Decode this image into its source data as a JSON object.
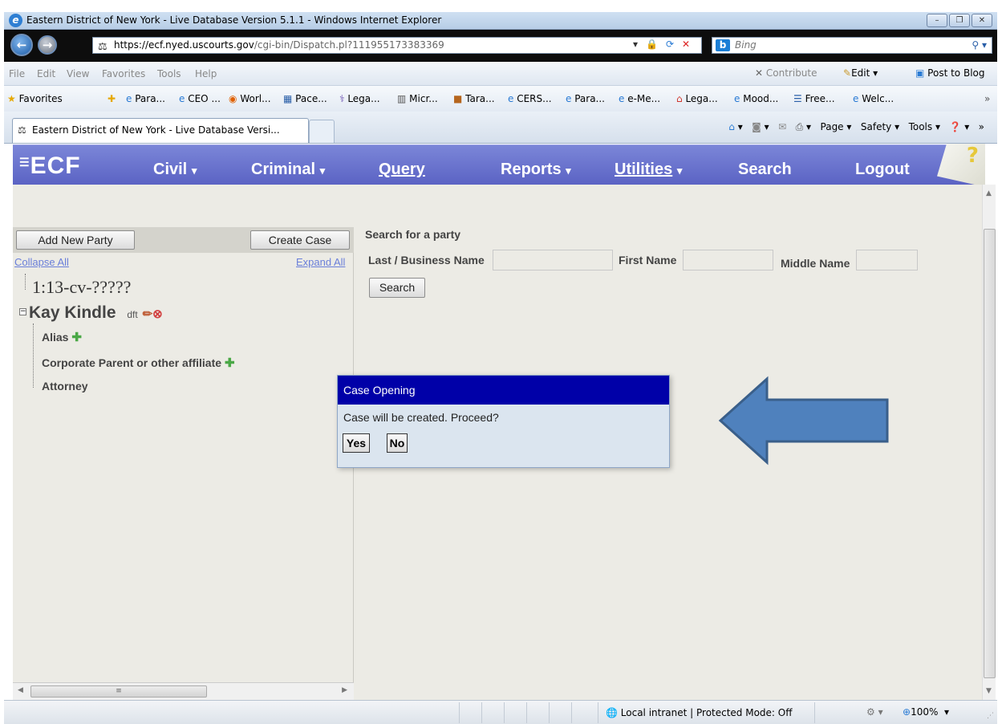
{
  "window": {
    "title": "Eastern District of New York - Live Database Version 5.1.1 - Windows Internet Explorer",
    "url_domain": "https://ecf.nyed.uscourts.gov",
    "url_path": "/cgi-bin/Dispatch.pl?111955173383369",
    "search_placeholder": "Bing",
    "controls": [
      "–",
      "❐",
      "✕"
    ]
  },
  "menubar": {
    "items": [
      "File",
      "Edit",
      "View",
      "Favorites",
      "Tools",
      "Help"
    ],
    "contribute": "Contribute",
    "edit": "Edit",
    "post": "Post to Blog"
  },
  "favorites": {
    "label": "Favorites",
    "items": [
      "Para...",
      "CEO ...",
      "Worl...",
      "Pace...",
      "Lega...",
      "Micr...",
      "Tara...",
      "CERS...",
      "Para...",
      "e-Me...",
      "Lega...",
      "Mood...",
      "Free...",
      "Welc..."
    ]
  },
  "tab": {
    "label": "Eastern District of New York - Live Database Versi..."
  },
  "commandbar": {
    "page": "Page",
    "safety": "Safety",
    "tools": "Tools"
  },
  "ecf": {
    "logo": "ECF",
    "nav": [
      "Civil",
      "Criminal",
      "Query",
      "Reports",
      "Utilities",
      "Search",
      "Logout"
    ]
  },
  "left_panel": {
    "add_party": "Add New Party",
    "create_case": "Create Case",
    "collapse": "Collapse All",
    "expand": "Expand All",
    "case_number": "1:13-cv-?????",
    "party_name": "Kay Kindle",
    "party_role": "dft",
    "children": [
      "Alias",
      "Corporate Parent or other affiliate",
      "Attorney"
    ]
  },
  "search_form": {
    "heading": "Search for a party",
    "last_name_label": "Last / Business Name",
    "first_name_label": "First Name",
    "middle_name_label": "Middle Name",
    "last_name_value": "",
    "first_name_value": "",
    "middle_name_value": "",
    "search_button": "Search"
  },
  "dialog": {
    "title": "Case Opening",
    "message": "Case will be created. Proceed?",
    "yes": "Yes",
    "no": "No"
  },
  "statusbar": {
    "zone": "Local intranet | Protected Mode: Off",
    "zoom": "100%"
  },
  "colors": {
    "ecf_nav": "#5b63c4",
    "dialog_title": "#0000a8",
    "arrow_fill": "#4f81bd",
    "arrow_stroke": "#3a5f8a"
  }
}
